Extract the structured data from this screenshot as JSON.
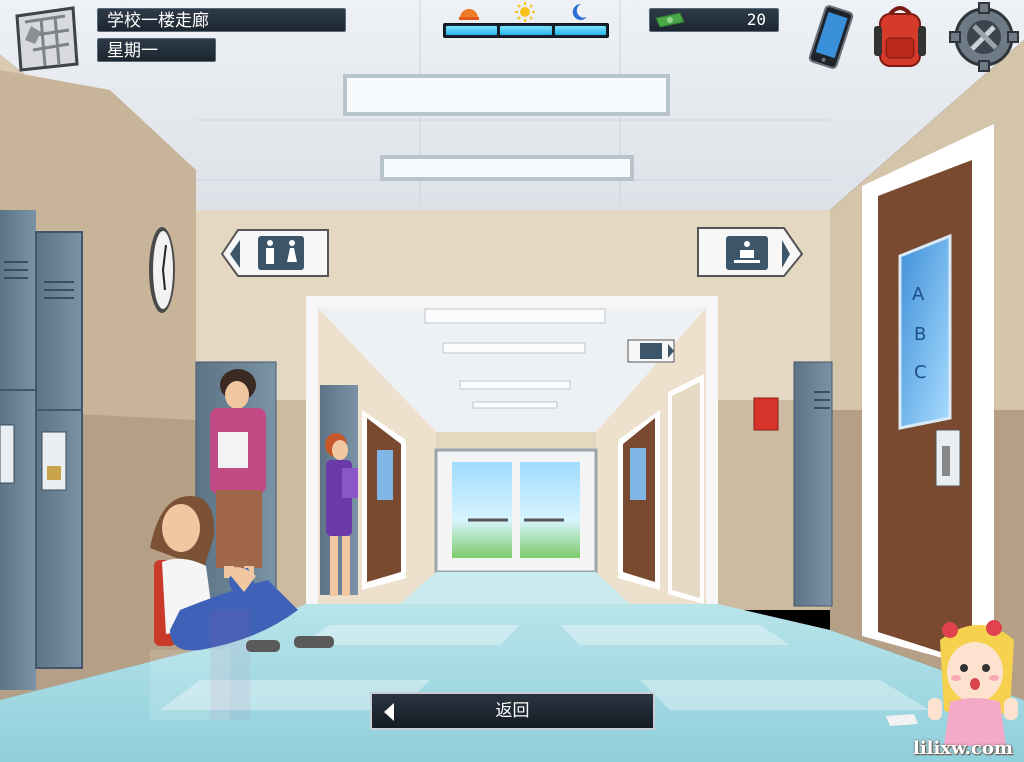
{
  "hud": {
    "location": "学校一楼走廊",
    "weekday": "星期一",
    "money": "20",
    "time_segments": 3,
    "time_icons": [
      "morning-sun-icon",
      "sun-icon",
      "moon-icon"
    ]
  },
  "buttons": {
    "back_label": "返回"
  },
  "watermark": "lilixw.com",
  "colors": {
    "time_fill": "#28b6ea",
    "hud_bg": "#1b2630",
    "wall": "#d7c9b0",
    "floor": "#a9dde6"
  }
}
